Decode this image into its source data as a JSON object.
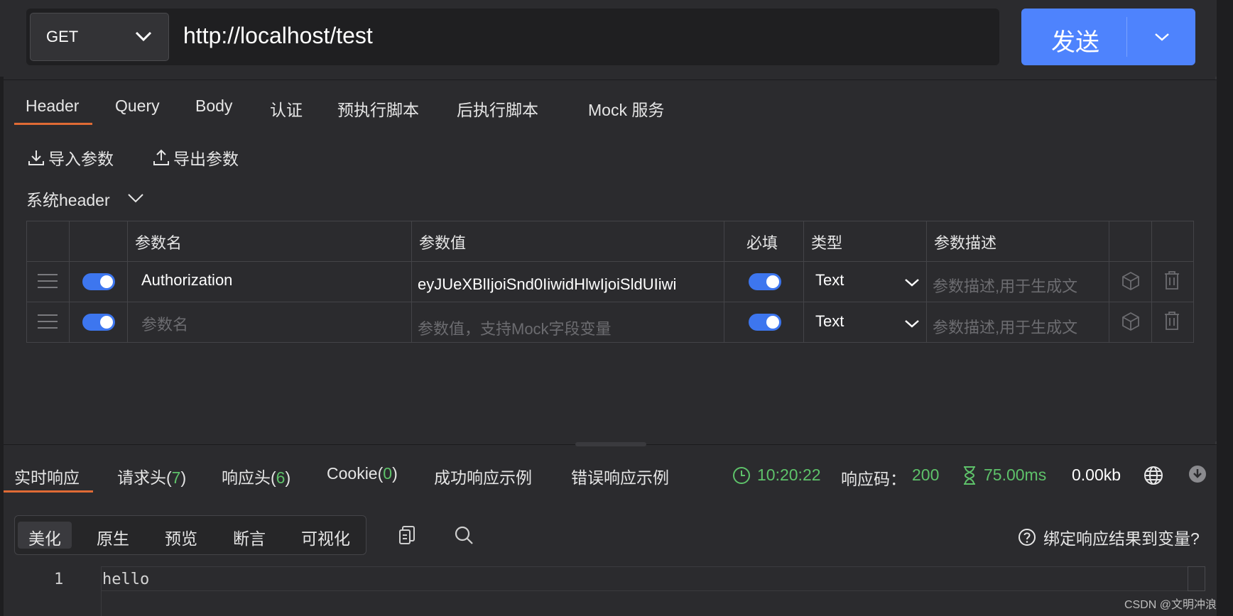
{
  "request": {
    "method": "GET",
    "url": "http://localhost/test",
    "send_label": "发送"
  },
  "tabs": [
    "Header",
    "Query",
    "Body",
    "认证",
    "预执行脚本",
    "后执行脚本",
    "Mock 服务"
  ],
  "active_tab": "Header",
  "actions": {
    "import": "导入参数",
    "export": "导出参数"
  },
  "system_header_label": "系统header",
  "table": {
    "headers": [
      "参数名",
      "参数值",
      "必填",
      "类型",
      "参数描述"
    ],
    "rows": [
      {
        "name": "Authorization",
        "value": "eyJUeXBlIjoiSnd0IiwidHlwIjoiSldUIiwi",
        "type": "Text",
        "desc_placeholder": "参数描述,用于生成文",
        "enabled": true,
        "required": true
      },
      {
        "name_placeholder": "参数名",
        "value_placeholder": "参数值，支持Mock字段变量",
        "type": "Text",
        "desc_placeholder": "参数描述,用于生成文",
        "enabled": true,
        "required": true
      }
    ]
  },
  "response_tabs": {
    "realtime": "实时响应",
    "req_headers": "请求头(",
    "req_headers_count": "7",
    "resp_headers": "响应头(",
    "resp_headers_count": "6",
    "cookie": "Cookie(",
    "cookie_count": "0",
    "close_paren": ")",
    "success_example": "成功响应示例",
    "error_example": "错误响应示例"
  },
  "response_stats": {
    "time": "10:20:22",
    "code_label": "响应码：",
    "code": "200",
    "duration": "75.00ms",
    "size": "0.00kb"
  },
  "view_modes": [
    "美化",
    "原生",
    "预览",
    "断言",
    "可视化"
  ],
  "active_view": "美化",
  "bind_question": "绑定响应结果到变量?",
  "editor": {
    "line_number": "1",
    "content": "hello"
  },
  "watermark": "CSDN @文明冲浪",
  "colors": {
    "accent": "#4e83fd",
    "tab_underline": "#e06b35",
    "success_green": "#5ec26a",
    "background": "#2b2b2e"
  }
}
